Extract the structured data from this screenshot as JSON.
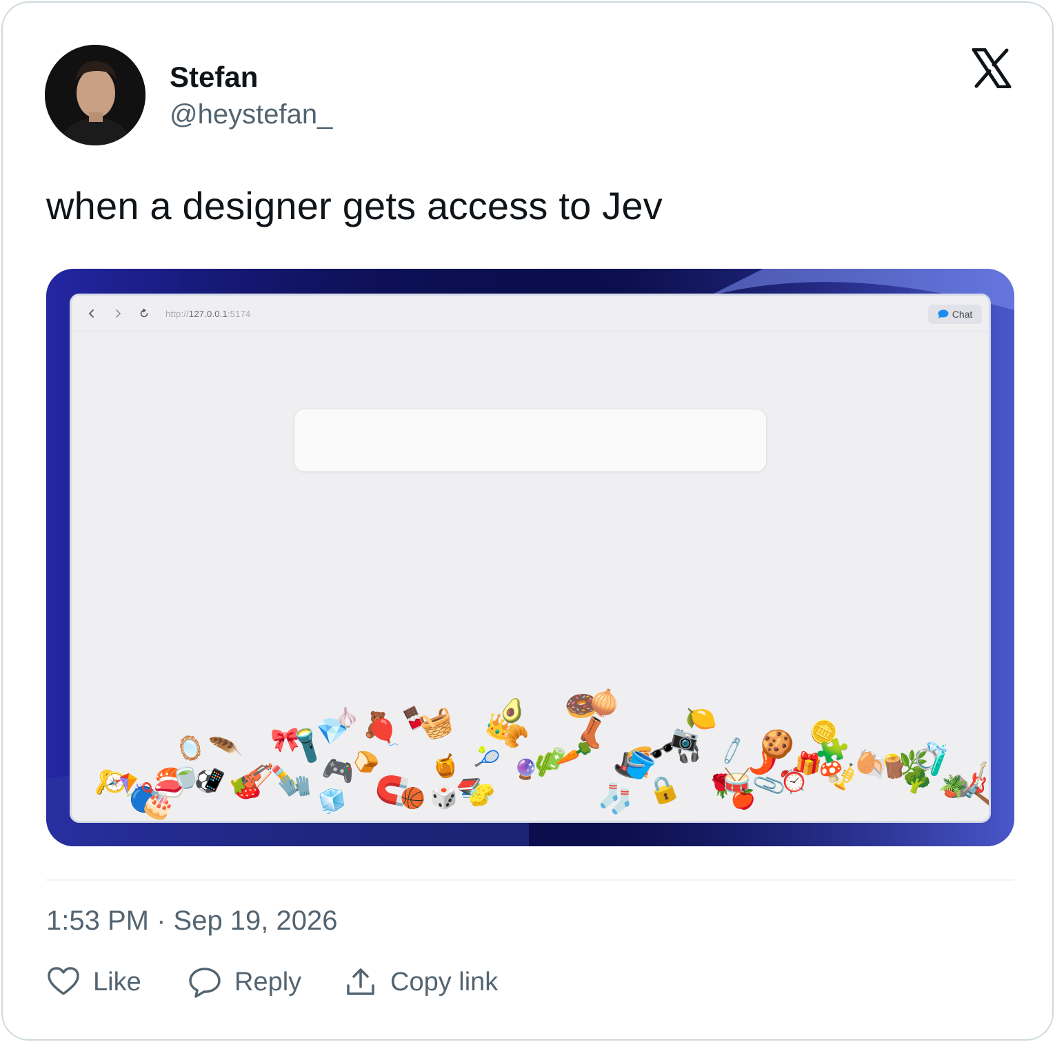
{
  "author": {
    "name": "Stefan",
    "handle": "@heystefan_",
    "avatar_icon": "profile-photo"
  },
  "brand_icon": "x-logo",
  "tweet_text": "when a designer gets access to Jev",
  "media": {
    "browser": {
      "url_prefix": "http://",
      "url_host": "127.0.0.1",
      "url_port": ":5174",
      "chat_label": "Chat"
    },
    "emoji_pile": [
      "🔑",
      "🧭",
      "🪁",
      "🔵",
      "✂️",
      "🎂",
      "🍣",
      "🍵",
      "🪞",
      "⚽",
      "📱",
      "🪶",
      "🧹",
      "🍓",
      "🎻",
      "✏️",
      "🎀",
      "🧤",
      "🔦",
      "💎",
      "🧊",
      "🎮",
      "🧄",
      "🍞",
      "🧸",
      "🎈",
      "🧲",
      "🍫",
      "🏀",
      "🧺",
      "🎲",
      "🍯",
      "📚",
      "🧽",
      "🎾",
      "👑",
      "🥐",
      "🥑",
      "🔮",
      "🌵",
      "🔋",
      "🥕",
      "🍩",
      "👢",
      "🧅",
      "🧦",
      "🎩",
      "🍕",
      "🪣",
      "🔒",
      "🕶️",
      "🎧",
      "📷",
      "🍋",
      "🌹",
      "🧷",
      "🥁",
      "🍎",
      "🌶️",
      "📎",
      "🍪",
      "⏰",
      "🎁",
      "🪙",
      "🍄",
      "🧩",
      "🎺",
      "🐚",
      "🥚",
      "💡",
      "🪵",
      "🌿",
      "🥦",
      "💍",
      "🧪",
      "🪨",
      "🪴",
      "🎸",
      "🔨"
    ]
  },
  "timestamp": "1:53 PM · Sep 19, 2026",
  "actions": {
    "like": "Like",
    "reply": "Reply",
    "copy_link": "Copy link"
  },
  "colors": {
    "text_primary": "#0f1419",
    "text_secondary": "#536471",
    "border": "#cfd9de",
    "media_bg": "#0c0f55"
  }
}
